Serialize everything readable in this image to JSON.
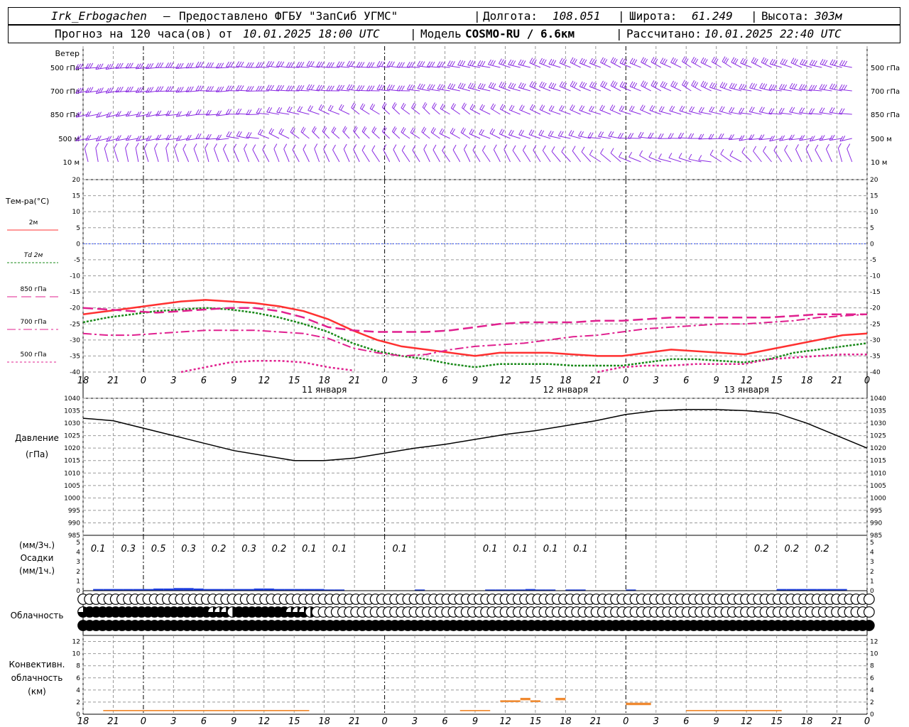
{
  "header": {
    "station": "Irk_Erbogachen",
    "dash": "–",
    "provider": "Предоставлено ФГБУ \"ЗапСиб УГМС\"",
    "sep": "|",
    "lon_label": "Долгота:",
    "lon_value": "108.051",
    "lat_label": "Широта:",
    "lat_value": "61.249",
    "alt_label": "Высота:",
    "alt_value": "303м",
    "forecast_label": "Прогноз на 120 часа(ов) от",
    "forecast_from": "10.01.2025 18:00 UTC",
    "model_label": "Модель",
    "model_value": "COSMO-RU / 6.6км",
    "calc_label": "Рассчитано:",
    "calc_value": "10.01.2025 22:40 UTC"
  },
  "colors": {
    "wind": "#8a2be2",
    "t2m": "#ff3030",
    "td2m": "#1a8a1a",
    "t850": "#e0208f",
    "zero": "#3050ff",
    "pressure": "#000000",
    "precip": "#2040e0",
    "conv": "#f08a30",
    "grid": "#999999"
  },
  "time_axis": {
    "ticks": [
      "18",
      "21",
      "0",
      "3",
      "6",
      "9",
      "12",
      "15",
      "18",
      "21",
      "0",
      "3",
      "6",
      "9",
      "12",
      "15",
      "18",
      "21",
      "0",
      "3",
      "6",
      "9",
      "12",
      "15",
      "18",
      "21",
      "0"
    ],
    "day_labels": [
      "11 января",
      "12 января",
      "13 января"
    ]
  },
  "wind_panel": {
    "title": "Ветер",
    "levels": [
      "500 гПа",
      "700 гПа",
      "850 гПа",
      "500 м",
      "10 м"
    ]
  },
  "chart_data": [
    {
      "type": "line",
      "title": "Тем-ра(°C)",
      "ylim": [
        -40,
        20
      ],
      "y_ticks": [
        "20",
        "15",
        "10",
        "5",
        "0",
        "-5",
        "-10",
        "-15",
        "-20",
        "-25",
        "-30",
        "-35",
        "-40"
      ],
      "x_hours": [
        0,
        3,
        6,
        9,
        12,
        15,
        18,
        21,
        24,
        27,
        30,
        33,
        36,
        39,
        42,
        45,
        48,
        51,
        54,
        57,
        60,
        63,
        66,
        69,
        72
      ],
      "series": [
        {
          "name": "2м",
          "values": [
            -22,
            -21,
            -20,
            -19,
            -18,
            -17.5,
            -18,
            -18.5,
            -19.5,
            -21,
            -23.5,
            -27,
            -30,
            -32,
            -33,
            -34,
            -35,
            -34,
            -34,
            -34,
            -34.5,
            -35,
            -35,
            -34,
            -33,
            -33.5,
            -34,
            -34.5,
            -33,
            -31.5,
            -30,
            -28.5,
            -28
          ]
        },
        {
          "name": "Td 2м",
          "values": [
            -24.5,
            -23,
            -22,
            -21,
            -20.5,
            -20,
            -20.5,
            -21.5,
            -23,
            -25,
            -27.5,
            -31,
            -33.5,
            -35,
            -36,
            -37.5,
            -38.5,
            -37.5,
            -37.5,
            -37.5,
            -38,
            -38,
            -38,
            -37,
            -36,
            -36,
            -36.5,
            -37,
            -36,
            -34,
            -33,
            -32,
            -31
          ]
        },
        {
          "name": "850 гПа",
          "values": [
            -20,
            -20.5,
            -21,
            -21.5,
            -21,
            -20.5,
            -20,
            -20,
            -21,
            -23,
            -26,
            -27,
            -27.5,
            -27.5,
            -27.5,
            -27,
            -26,
            -25,
            -24.5,
            -24.5,
            -24.5,
            -24,
            -24,
            -23.5,
            -23,
            -23,
            -23,
            -23,
            -23,
            -22.5,
            -22,
            -22,
            -22
          ]
        },
        {
          "name": "700 гПа",
          "values": [
            -28,
            -28.5,
            -28.5,
            -28,
            -27.5,
            -27,
            -27,
            -27,
            -27.5,
            -28,
            -29.5,
            -32.5,
            -34,
            -35,
            -34.5,
            -33,
            -32,
            -31.5,
            -31,
            -30,
            -29,
            -28.5,
            -27.5,
            -26.5,
            -26,
            -25.5,
            -25,
            -25,
            -24.5,
            -24,
            -23,
            -22.5,
            -22
          ]
        },
        {
          "name": "500 гПа",
          "values": [
            null,
            null,
            null,
            null,
            -40,
            -38.5,
            -37,
            -36.5,
            -36.5,
            -37,
            -38.5,
            -39.5,
            null,
            null,
            null,
            null,
            null,
            null,
            null,
            null,
            null,
            -40,
            -38.5,
            -38,
            -38,
            -37.5,
            -37.5,
            -37.5,
            -36,
            -35.5,
            -35,
            -34.5,
            -34.5
          ]
        }
      ]
    },
    {
      "type": "line",
      "title": "Давление",
      "unit": "(гПа)",
      "ylim": [
        985,
        1040
      ],
      "y_ticks": [
        "1040",
        "1035",
        "1030",
        "1025",
        "1020",
        "1015",
        "1010",
        "1005",
        "1000",
        "995",
        "990",
        "985"
      ],
      "series": [
        {
          "name": "Давление",
          "values": [
            1032,
            1031,
            1028,
            1025,
            1022,
            1019,
            1017,
            1015,
            1015,
            1016,
            1018,
            1020,
            1021.5,
            1023.5,
            1025.5,
            1027,
            1029,
            1031,
            1033.5,
            1035,
            1035.5,
            1035.5,
            1035,
            1034,
            1030,
            1025,
            1020
          ]
        }
      ]
    },
    {
      "type": "bar",
      "title": "Осадки",
      "units": [
        "(мм/3ч.)",
        "(мм/1ч.)"
      ],
      "ylim": [
        0,
        5
      ],
      "y_ticks": [
        "5",
        "4",
        "3",
        "2",
        "1",
        "0"
      ],
      "labels_3h": [
        {
          "hour": 3,
          "text": "0.1"
        },
        {
          "hour": 6,
          "text": "0.3"
        },
        {
          "hour": 9,
          "text": "0.5"
        },
        {
          "hour": 12,
          "text": "0.3"
        },
        {
          "hour": 15,
          "text": "0.2"
        },
        {
          "hour": 18,
          "text": "0.3"
        },
        {
          "hour": 21,
          "text": "0.2"
        },
        {
          "hour": 24,
          "text": "0.1"
        },
        {
          "hour": 27,
          "text": "0.1"
        },
        {
          "hour": 33,
          "text": "0.1"
        },
        {
          "hour": 42,
          "text": "0.1"
        },
        {
          "hour": 45,
          "text": "0.1"
        },
        {
          "hour": 48,
          "text": "0.1"
        },
        {
          "hour": 51,
          "text": "0.1"
        },
        {
          "hour": 69,
          "text": "0.2"
        },
        {
          "hour": 72,
          "text": "0.2"
        },
        {
          "hour": 75,
          "text": "0.2"
        }
      ],
      "values_1h": [
        0,
        0.1,
        0.1,
        0.1,
        0.1,
        0.1,
        0.1,
        0.15,
        0.15,
        0.2,
        0.2,
        0.15,
        0.1,
        0.1,
        0.1,
        0.1,
        0.1,
        0.15,
        0.15,
        0.1,
        0.1,
        0.1,
        0.1,
        0.1,
        0.05,
        0.05,
        0,
        0,
        0,
        0,
        0,
        0,
        0,
        0.05,
        0,
        0,
        0,
        0,
        0,
        0,
        0.05,
        0.05,
        0.05,
        0.05,
        0.1,
        0.05,
        0.05,
        0,
        0.05,
        0.05,
        0,
        0,
        0,
        0,
        0.05,
        0,
        0,
        0,
        0,
        0,
        0,
        0,
        0,
        0,
        0,
        0,
        0,
        0,
        0,
        0.1,
        0.1,
        0.1,
        0.1,
        0.1,
        0.1,
        0.1
      ]
    },
    {
      "type": "table",
      "title": "Облачность",
      "rows": [
        {
          "name": "upper",
          "values": [
            0,
            0,
            0,
            0,
            0,
            0,
            0,
            0,
            0,
            0,
            0,
            0,
            0,
            0,
            0,
            0,
            0,
            0,
            0,
            0,
            0,
            0,
            0,
            0,
            0,
            0,
            0,
            0,
            0,
            0,
            0,
            0,
            0,
            0,
            0,
            0,
            0,
            0,
            0,
            0,
            0,
            0,
            0,
            0,
            0,
            0,
            0,
            0,
            0,
            0,
            0,
            0,
            0,
            0,
            0,
            0,
            0,
            0,
            0,
            0,
            0,
            0,
            0,
            0,
            0,
            0,
            0,
            0,
            0,
            0,
            0,
            0,
            0,
            0,
            0,
            0,
            0,
            0,
            0,
            0,
            0,
            0,
            0,
            0,
            0,
            0,
            0,
            0,
            0,
            0,
            0,
            0,
            0,
            0,
            0,
            0,
            0,
            0,
            0,
            0,
            0,
            0,
            0,
            0,
            0,
            0,
            0,
            0,
            0,
            0,
            0,
            0,
            0,
            0,
            0,
            0,
            0,
            0,
            0,
            0,
            0,
            0
          ]
        },
        {
          "name": "middle",
          "values": [
            3,
            4,
            4,
            4,
            4,
            4,
            4,
            4,
            4,
            4,
            4,
            4,
            4,
            4,
            4,
            4,
            4,
            4,
            4,
            4,
            3,
            3,
            3,
            2,
            4,
            4,
            4,
            4,
            4,
            4,
            4,
            4,
            3,
            3,
            3,
            2,
            0,
            0,
            0,
            0,
            0,
            0,
            0,
            0,
            0,
            0,
            0,
            0,
            0,
            0,
            0,
            0,
            0,
            0,
            0,
            0,
            0,
            0,
            0,
            0,
            0,
            0,
            0,
            0,
            0,
            0,
            0,
            0,
            0,
            0,
            0,
            0,
            0,
            0,
            0,
            0,
            0,
            0,
            0,
            0,
            0,
            0,
            0,
            0,
            0,
            0,
            0,
            0,
            0,
            0,
            0,
            0,
            0,
            0,
            0,
            0,
            0,
            0,
            0,
            0,
            0,
            0,
            0,
            0,
            0,
            0,
            0,
            0,
            0,
            0,
            0,
            0,
            0,
            0,
            0,
            0,
            0,
            0,
            0,
            0,
            0,
            0
          ]
        },
        {
          "name": "lower",
          "values": [
            4,
            4,
            4,
            4,
            4,
            4,
            4,
            4,
            4,
            4,
            4,
            4,
            4,
            4,
            4,
            4,
            4,
            4,
            4,
            4,
            4,
            4,
            4,
            4,
            4,
            4,
            4,
            4,
            4,
            4,
            4,
            4,
            4,
            4,
            4,
            4,
            4,
            4,
            4,
            4,
            4,
            4,
            4,
            4,
            4,
            4,
            4,
            4,
            4,
            4,
            4,
            4,
            4,
            4,
            4,
            4,
            4,
            4,
            4,
            4,
            4,
            4,
            4,
            4,
            4,
            4,
            4,
            4,
            4,
            4,
            4,
            4,
            4,
            4,
            4,
            4,
            4,
            4,
            4,
            4,
            4,
            4,
            4,
            4,
            4,
            4,
            4,
            4,
            4,
            4,
            4,
            4,
            4,
            4,
            4,
            4,
            4,
            4,
            4,
            4,
            4,
            4,
            4,
            4,
            4,
            4,
            4,
            4,
            4,
            4,
            4,
            4,
            4,
            4,
            4,
            4,
            4,
            4,
            4,
            4,
            4,
            4
          ]
        }
      ]
    },
    {
      "type": "bar",
      "title": "Конвективн.",
      "title2": "облачность",
      "unit": "(км)",
      "ylim": [
        0,
        13
      ],
      "y_ticks": [
        "12",
        "10",
        "8",
        "6",
        "4",
        "2",
        "0"
      ],
      "segments": [
        {
          "from": 2,
          "to": 22.5,
          "base": 0.5,
          "top": 0.7
        },
        {
          "from": 37.5,
          "to": 40.5,
          "base": 0.5,
          "top": 0.7
        },
        {
          "from": 41.5,
          "to": 43.5,
          "base": 2,
          "top": 2.3
        },
        {
          "from": 43.5,
          "to": 44.5,
          "base": 2.3,
          "top": 2.7
        },
        {
          "from": 44.5,
          "to": 45.5,
          "base": 2,
          "top": 2.3
        },
        {
          "from": 47,
          "to": 48,
          "base": 2.3,
          "top": 2.7
        },
        {
          "from": 54,
          "to": 56.5,
          "base": 1.5,
          "top": 1.9
        },
        {
          "from": 60,
          "to": 69.5,
          "base": 0.5,
          "top": 0.7
        }
      ]
    }
  ]
}
